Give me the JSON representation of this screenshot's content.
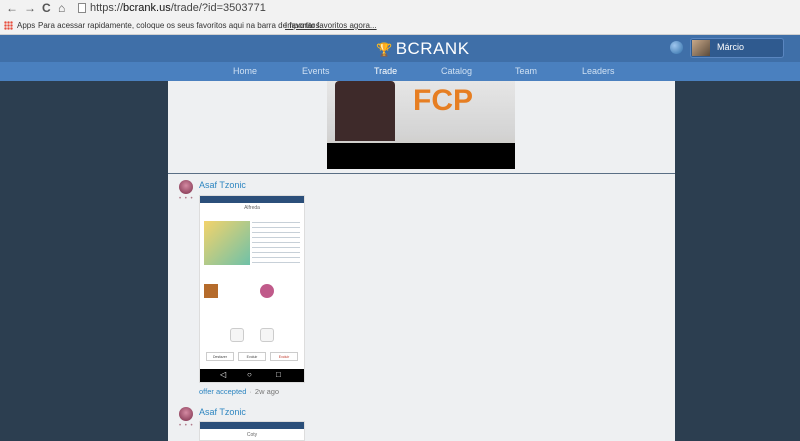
{
  "browser": {
    "url_prefix": "https://",
    "url_host": "bcrank.us",
    "url_path": "/trade/?id=3503771",
    "nav_back": "←",
    "nav_forward": "→",
    "nav_reload": "C",
    "nav_home": "⌂",
    "bookmarks": {
      "apps_label": "Apps",
      "hint_text": "Para acessar rapidamente, coloque os seus favoritos aqui na barra de favoritos.",
      "import_link": "Importar favoritos agora..."
    }
  },
  "header": {
    "logo_text": "BCRANK",
    "user_name": "Márcio"
  },
  "nav": {
    "items": [
      {
        "label": "Home"
      },
      {
        "label": "Events"
      },
      {
        "label": "Trade"
      },
      {
        "label": "Catalog"
      },
      {
        "label": "Team"
      },
      {
        "label": "Leaders"
      }
    ],
    "active": "Trade"
  },
  "posts": [
    {
      "user": "Asaf Tzonic",
      "status": "offer accepted",
      "ago": "2w ago",
      "screenshot_title": "Alfreda",
      "buttons": [
        "Desfazer",
        "Evoluir",
        "Excluir"
      ]
    },
    {
      "user": "Asaf Tzonic",
      "screenshot_title": "Coty"
    }
  ],
  "dots": "• • •",
  "photo_banner": "FCP"
}
